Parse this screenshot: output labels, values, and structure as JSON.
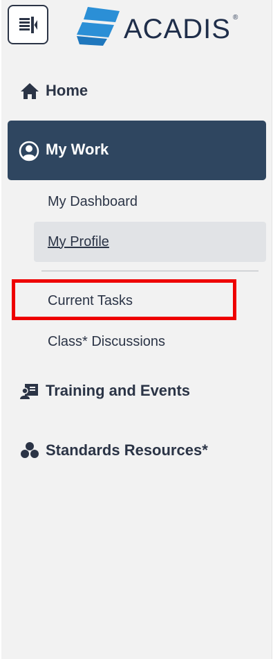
{
  "header": {
    "menu_toggle_icon": "collapse-sidebar-icon",
    "logo_text": "ACADIS",
    "logo_registered": "®"
  },
  "nav": {
    "home": {
      "label": "Home",
      "icon": "house-icon"
    },
    "my_work": {
      "label": "My Work",
      "icon": "user-circle-icon",
      "items": [
        {
          "label": "My Dashboard"
        },
        {
          "label": "My Profile",
          "active": true
        },
        {
          "label": "Current Tasks",
          "highlighted": true
        },
        {
          "label": "Class* Discussions"
        }
      ]
    },
    "training": {
      "label": "Training and Events",
      "icon": "presentation-icon"
    },
    "standards": {
      "label": "Standards Resources*",
      "icon": "cubes-icon"
    }
  },
  "colors": {
    "sidebar_bg": "#f2f2f2",
    "selected_bg": "#2f4660",
    "active_sub_bg": "#e1e3e6",
    "text_dark": "#2b3446",
    "logo_blue": "#2b8fd6",
    "highlight_red": "#ee0000"
  }
}
